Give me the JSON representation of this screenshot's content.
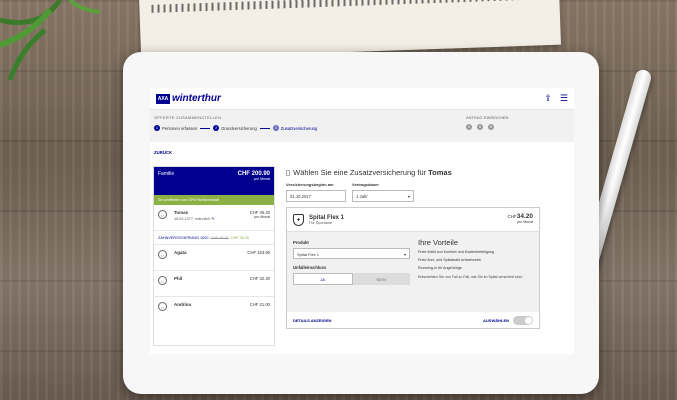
{
  "header": {
    "logo_mark": "AXA",
    "logo_text": "winterthur"
  },
  "steps": {
    "title": "OFFERTE ZUSAMMENSTELLEN",
    "items": [
      {
        "num": "1",
        "label": "Personen erfassen"
      },
      {
        "num": "2",
        "label": "Grundversicherung"
      },
      {
        "num": "3",
        "label": "Zusatzversicherung"
      }
    ],
    "antrag_title": "ANTRAG EINREICHEN",
    "antrag_dots": [
      "4",
      "5",
      "6"
    ]
  },
  "back_label": "ZURÜCK",
  "family": {
    "title": "Familie",
    "price": "CHF 200.90",
    "per": "pro Monat",
    "discount_note": "Sie profitieren von 10% Familienrabatt",
    "persons": [
      {
        "name": "Tomas",
        "sub": "16.02.1977, männlich",
        "price": "CHF 45.20",
        "per": "pro Monat"
      },
      {
        "name": "Agata",
        "sub": "",
        "price": "CHF 153.90",
        "per": ""
      },
      {
        "name": "Phil",
        "sub": "",
        "price": "CHF 32.30",
        "per": ""
      },
      {
        "name": "Andrina",
        "sub": "",
        "price": "CHF 21.00",
        "per": ""
      }
    ],
    "zusatz": {
      "label": "ZAHNVERSICHERUNG 1000",
      "old": "CHF 48.00",
      "new": "CHF 45.20"
    }
  },
  "main": {
    "heading_prefix": "Wählen Sie eine Zusatzversicherung für",
    "heading_name": "Tomas",
    "start_label": "Versicherungsbeginn am",
    "start_value": "01.10.2017",
    "duration_label": "Vertragsdauer",
    "duration_value": "1 Jahr",
    "product": {
      "name": "Spital Flex 1",
      "sub": "Für Spontane",
      "currency": "CHF",
      "price": "34.20",
      "per": "pro Monat"
    },
    "produkt_label": "Produkt",
    "produkt_value": "Spital Flex 1",
    "unfall_label": "Unfalleinschluss",
    "unfall_yes": "JA",
    "unfall_no": "NEIN",
    "vorteile_title": "Ihre Vorteile",
    "vorteile": [
      "Freie Wahl von Komfort und Kostenbeteiligung",
      "Freie Arzt- und Spitalwahl schweizweit",
      "Rooming-in für Angehörige"
    ],
    "note": "Entscheiden Sie von Fall zu Fall, wie Sie im Spital versichert sind.",
    "details_label": "DETAILS ANZEIGEN",
    "auswaehlen_label": "AUSWÄHLEN"
  }
}
